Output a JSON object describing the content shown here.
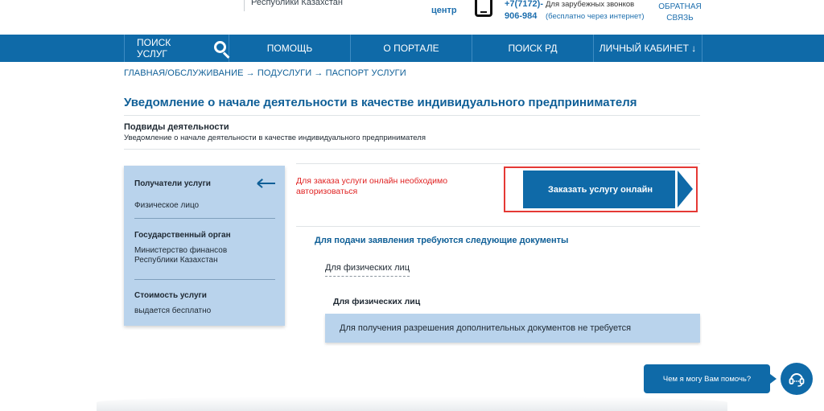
{
  "header": {
    "logo_text": "",
    "gov_text": "Республики Казахстан",
    "center_text": "центр",
    "phone": "+7(7172)-",
    "phone_2": "906-984",
    "phone_note": "Для зарубежных звонков",
    "phone_note_sub": "(бесплатно через интернет)",
    "feedback_1": "ОБРАТНАЯ",
    "feedback_2": "СВЯЗЬ"
  },
  "nav": {
    "items": [
      {
        "label": "ПОИСК УСЛУГ"
      },
      {
        "label": "ПОМОЩЬ"
      },
      {
        "label": "О ПОРТАЛЕ"
      },
      {
        "label": "ПОИСК РД"
      },
      {
        "label": "ЛИЧНЫЙ КАБИНЕТ ↓"
      }
    ]
  },
  "breadcrumb": "ГЛАВНАЯ/ОБСЛУЖИВАНИЕ → ПОДУСЛУГИ → ПАСПОРТ УСЛУГИ",
  "main": {
    "title": "Уведомление о начале деятельности в качестве индивидуального предпринимателя",
    "subtypes_label": "Подвиды деятельности",
    "subtypes_value": "Уведомление о начале деятельности в качестве индивидуального предпринимателя"
  },
  "info_card": {
    "recipients_label": "Получатели услуги",
    "recipients_value": "Физическое лицо",
    "agency_label": "Государственный орган",
    "agency_value_1": "Министерство финансов",
    "agency_value_2": "Республики Казахстан",
    "cost_label": "Стоимость услуги",
    "cost_value": "выдается бесплатно"
  },
  "order": {
    "warning_1": "Для заказа услуги онлайн необходимо",
    "warning_2": "авторизоваться",
    "button_label": "Заказать услугу онлайн"
  },
  "documents": {
    "title": "Для подачи заявления требуются следующие документы",
    "tab_label": "Для физических лиц",
    "section_label": "Для физических лиц",
    "box_text": "Для получения разрешения дополнительных документов не требуется"
  },
  "chat": {
    "bubble_text": "Чем я могу Вам помочь?",
    "icon": "headset-icon"
  },
  "colors": {
    "primary": "#0f6aa8",
    "card_bg": "#b9d3ec",
    "warning": "#e02323",
    "frame": "#e53935"
  }
}
